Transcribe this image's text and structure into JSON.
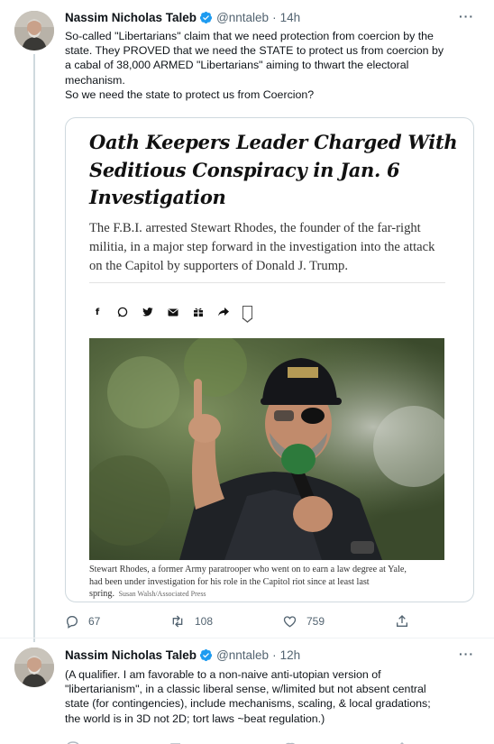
{
  "tweets": [
    {
      "author": "Nassim Nicholas Taleb",
      "handle": "@nntaleb",
      "time": "14h",
      "more_label": "···",
      "text_lines": [
        "So-called \"Libertarians\" claim that we need protection from coercion by the",
        "state. They PROVED that we need the STATE to protect us from coercion by",
        "a cabal of 38,000 ARMED \"Libertarians\" aiming to thwart the electoral",
        "mechanism.",
        "So we need the state to protect us from Coercion?"
      ],
      "card": {
        "headline_lines": [
          "Oath Keepers Leader Charged With",
          "Seditious Conspiracy in Jan. 6",
          "Investigation"
        ],
        "dek_lines": [
          "The F.B.I. arrested Stewart Rhodes, the founder of the far-right",
          "militia, in a major step forward in the investigation into the attack",
          "on the Capitol by supporters of Donald J. Trump."
        ],
        "share_icons": [
          "facebook-icon",
          "whatsapp-icon",
          "twitter-icon",
          "email-icon",
          "gift-icon",
          "share-arrow-icon",
          "bookmark-icon"
        ],
        "share_glyphs": [
          "f",
          "◎",
          "🐦",
          "✉",
          "🎁",
          "➦"
        ],
        "caption_lines": [
          "Stewart Rhodes, a former Army paratrooper who went on to earn a law degree at Yale,",
          "had been under investigation for his role in the Capitol riot since at least last",
          "spring."
        ],
        "caption_credit": "Susan Walsh/Associated Press"
      },
      "actions": {
        "replies": "67",
        "retweets": "108",
        "likes": "759"
      }
    },
    {
      "author": "Nassim Nicholas Taleb",
      "handle": "@nntaleb",
      "time": "12h",
      "more_label": "···",
      "text_lines": [
        "(A qualifier. I am favorable to a non-naive anti-utopian version of",
        "\"libertarianism\", in a classic liberal sense, w/limited but not absent central",
        "state (for contingencies), include mechanisms, scaling, & local gradations;",
        "the world is in 3D not 2D; tort laws ~beat regulation.)"
      ]
    }
  ],
  "colors": {
    "text": "#0f1419",
    "secondary": "#536471",
    "verified": "#1d9bf0",
    "border": "#cfd9de"
  }
}
